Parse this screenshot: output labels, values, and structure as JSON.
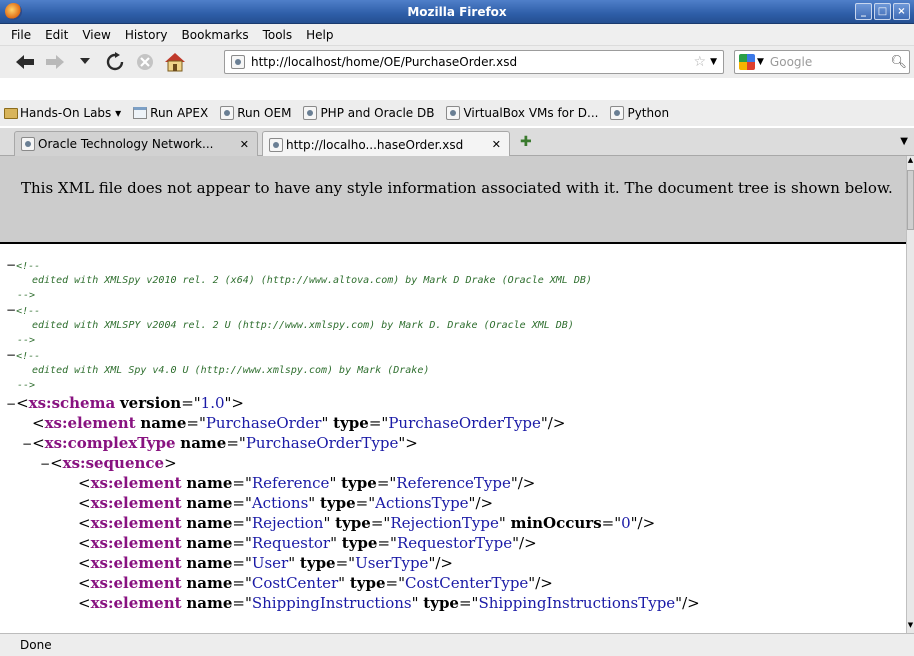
{
  "window": {
    "title": "Mozilla Firefox"
  },
  "menu": [
    {
      "label": "File"
    },
    {
      "label": "Edit"
    },
    {
      "label": "View"
    },
    {
      "label": "History"
    },
    {
      "label": "Bookmarks"
    },
    {
      "label": "Tools"
    },
    {
      "label": "Help"
    }
  ],
  "nav": {
    "url": "http://localhost/home/OE/PurchaseOrder.xsd",
    "search_placeholder": "Google"
  },
  "bookmarks": [
    {
      "label": "Hands-On Labs ▾",
      "icon": "folder-icon"
    },
    {
      "label": "Run APEX",
      "icon": "page-icon"
    },
    {
      "label": "Run OEM",
      "icon": "globe-icon"
    },
    {
      "label": "PHP and Oracle DB",
      "icon": "globe-icon"
    },
    {
      "label": "VirtualBox VMs for D...",
      "icon": "globe-icon"
    },
    {
      "label": "Python",
      "icon": "globe-icon"
    }
  ],
  "tabs": [
    {
      "label": "Oracle Technology Network...",
      "active": false
    },
    {
      "label": "http://localho...haseOrder.xsd",
      "active": true
    }
  ],
  "content": {
    "notice": "This XML file does not appear to have any style information associated with it. The document tree is shown below.",
    "comments": [
      "edited with XMLSpy v2010 rel. 2 (x64) (http://www.altova.com) by Mark D Drake (Oracle XML DB)",
      "edited with XMLSPY v2004 rel. 2 U (http://www.xmlspy.com) by Mark D. Drake (Oracle XML DB)",
      "edited with XML Spy v4.0 U (http://www.xmlspy.com) by Mark (Drake)"
    ],
    "schema": {
      "tag": "xs:schema",
      "attr": "version",
      "value": "1.0"
    },
    "root_element": {
      "tag": "xs:element",
      "name": "PurchaseOrder",
      "type": "PurchaseOrderType"
    },
    "complex_type": {
      "tag": "xs:complexType",
      "name": "PurchaseOrderType"
    },
    "sequence": {
      "tag": "xs:sequence"
    },
    "elements": [
      {
        "name": "Reference",
        "type": "ReferenceType"
      },
      {
        "name": "Actions",
        "type": "ActionsType"
      },
      {
        "name": "Rejection",
        "type": "RejectionType",
        "minOccurs": "0"
      },
      {
        "name": "Requestor",
        "type": "RequestorType"
      },
      {
        "name": "User",
        "type": "UserType"
      },
      {
        "name": "CostCenter",
        "type": "CostCenterType"
      },
      {
        "name": "ShippingInstructions",
        "type": "ShippingInstructionsType"
      }
    ]
  },
  "status": "Done"
}
